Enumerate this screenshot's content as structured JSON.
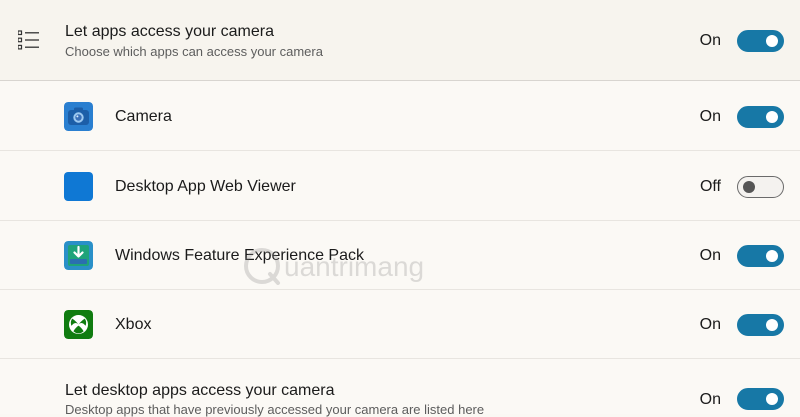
{
  "header": {
    "icon": "list-settings-icon",
    "title": "Let apps access your camera",
    "subtitle": "Choose which apps can access your camera",
    "state_label": "On",
    "toggle_on": true
  },
  "apps": [
    {
      "name": "Camera",
      "icon": "camera-app-icon",
      "state_label": "On",
      "toggle_on": true,
      "icon_color": "#2a7fd0"
    },
    {
      "name": "Desktop App Web Viewer",
      "icon": "desktop-app-web-viewer-icon",
      "state_label": "Off",
      "toggle_on": false,
      "icon_color": "#0f78d4"
    },
    {
      "name": "Windows Feature Experience Pack",
      "icon": "windows-feature-experience-pack-icon",
      "state_label": "On",
      "toggle_on": true,
      "icon_color": "#2a90c8"
    },
    {
      "name": "Xbox",
      "icon": "xbox-icon",
      "state_label": "On",
      "toggle_on": true,
      "icon_color": "#107c10"
    }
  ],
  "desktop_apps": {
    "title": "Let desktop apps access your camera",
    "subtitle": "Desktop apps that have previously accessed your camera are listed here",
    "state_label": "On",
    "toggle_on": true
  },
  "watermark": {
    "text": "uantrimang",
    "icon": "watermark-logo-icon"
  },
  "colors": {
    "accent": "#1778a6",
    "background": "#fbf9f5",
    "header_background": "#f7f4ee"
  }
}
